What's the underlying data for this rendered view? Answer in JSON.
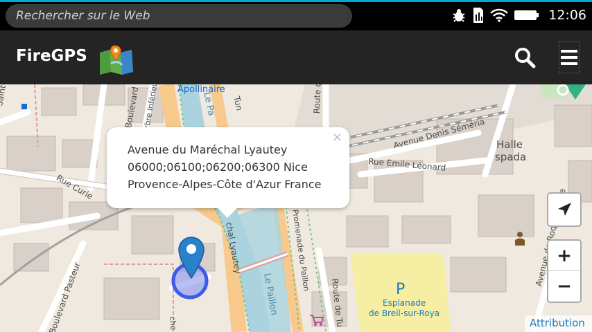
{
  "status_bar": {
    "search_placeholder": "Rechercher sur le Web",
    "time": "12:06",
    "icons": [
      "bug-icon",
      "sim-icon",
      "wifi-icon",
      "battery-icon"
    ]
  },
  "header": {
    "title": "FireGPS",
    "logo": "map-pin-logo",
    "search_icon": "search-icon",
    "menu_icon": "menu-icon"
  },
  "map": {
    "labels": {
      "apollinaire": "Apollinaire",
      "saint_yriel": "Saint-Yriel",
      "boulevard": "Boulevard",
      "arbre_inferieure": "Arbre Inférieure",
      "le_paillon_top": "Le Pa",
      "route_de": "Route de",
      "avenue_denis_semeria": "Avenue Denis Séméria",
      "halle": "Halle",
      "spada": "spada",
      "rue_emile_leonard": "Rue Emile Léonard",
      "rue_curie": "Rue Curie",
      "boulevard_pasteur": "Boulevard Pasteur",
      "chal_lyautey": "chal Lyautey",
      "le_paillon": "Le Paillon",
      "promenade_du_paillon": "Promenade du Paillon",
      "route_de_tu": "Route de Tu",
      "avenue_de_roquebilliere": "Avenue de Roquebillière",
      "esplanade": "Esplanade",
      "de_breil_sur_roya": "de Breil-sur-Roya",
      "parking": "P",
      "che": "che",
      "tun": "Tun"
    }
  },
  "popup": {
    "lines": [
      "Avenue du Maréchal Lyautey",
      "06000;06100;06200;06300 Nice",
      "Provence-Alpes-Côte d'Azur France"
    ],
    "close": "×"
  },
  "controls": {
    "zoom_in": "+",
    "zoom_out": "−",
    "attribution": "Attribution"
  },
  "colors": {
    "accent": "#00a8d6",
    "header_bg": "#242424",
    "main_road": "#f7c98d",
    "river": "#aad3df",
    "parking": "#f6eea2",
    "marker": "#2a81cb"
  }
}
